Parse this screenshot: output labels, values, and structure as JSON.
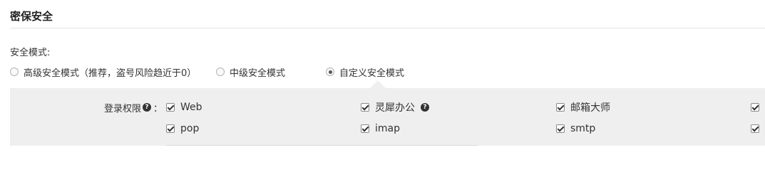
{
  "section": {
    "title": "密保安全"
  },
  "security_mode": {
    "label": "安全模式:",
    "options": [
      {
        "label": "高级安全模式（推荐，盗号风险趋近于0）",
        "checked": false
      },
      {
        "label": "中级安全模式",
        "checked": false
      },
      {
        "label": "自定义安全模式",
        "checked": true
      }
    ]
  },
  "login_permissions": {
    "label": "登录权限",
    "help_icon": "question-circle-icon",
    "colon": "：",
    "row1": [
      {
        "label": "Web",
        "checked": true
      },
      {
        "label": "灵犀办公",
        "checked": true,
        "help_icon": "question-circle-icon"
      },
      {
        "label": "邮箱大师",
        "checked": true
      },
      {
        "label": "",
        "checked": true
      }
    ],
    "row2": [
      {
        "label": "pop",
        "checked": true
      },
      {
        "label": "imap",
        "checked": true
      },
      {
        "label": "smtp",
        "checked": true
      },
      {
        "label": "",
        "checked": true
      }
    ]
  }
}
